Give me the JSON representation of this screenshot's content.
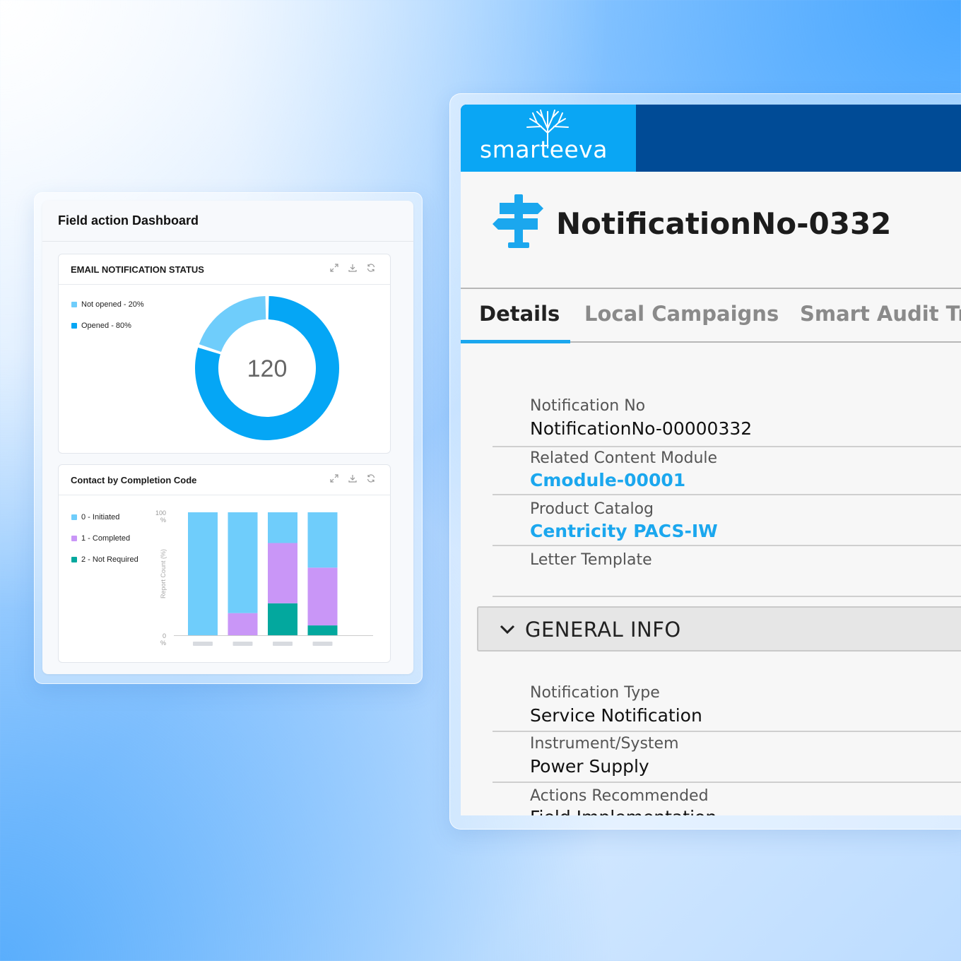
{
  "dashboard": {
    "title": "Field action Dashboard",
    "email_widget": {
      "title": "EMAIL NOTIFICATION STATUS",
      "center_value": "120",
      "legend": [
        {
          "label": "Not opened - 20%",
          "color": "#6fcdfb"
        },
        {
          "label": "Opened - 80%",
          "color": "#05a6f5"
        }
      ]
    },
    "contact_widget": {
      "title": "Contact by Completion Code",
      "legend": [
        {
          "label": "0 - Initiated",
          "color": "#6fcdfb"
        },
        {
          "label": "1 - Completed",
          "color": "#c996f7"
        },
        {
          "label": "2 - Not Required",
          "color": "#03a89e"
        }
      ]
    }
  },
  "chart_data": [
    {
      "type": "pie",
      "title": "EMAIL NOTIFICATION STATUS",
      "labels": [
        "Not opened",
        "Opened"
      ],
      "values": [
        20,
        80
      ],
      "center_label": "120",
      "colors": [
        "#6fcdfb",
        "#05a6f5"
      ]
    },
    {
      "type": "bar",
      "stacked": true,
      "title": "Contact by Completion Code",
      "ylabel": "Report Count (%)",
      "yticks": [
        "100\n%",
        "0\n%"
      ],
      "ylim": [
        0,
        100
      ],
      "categories": [
        "",
        "",
        "",
        ""
      ],
      "series": [
        {
          "name": "2 - Not Required",
          "values": [
            0,
            0,
            26,
            8
          ],
          "color": "#03a89e"
        },
        {
          "name": "1 - Completed",
          "values": [
            0,
            18,
            49,
            47
          ],
          "color": "#c996f7"
        },
        {
          "name": "0 - Initiated",
          "values": [
            100,
            82,
            25,
            45
          ],
          "color": "#6fcdfb"
        }
      ]
    }
  ],
  "notification": {
    "brand": "smarteeva",
    "title": "NotificationNo-0332",
    "tabs": [
      "Details",
      "Local Campaigns",
      "Smart Audit Tra"
    ],
    "fields": [
      {
        "label": "Notification No",
        "value": "NotificationNo-00000332",
        "link": false
      },
      {
        "label": "Related Content Module",
        "value": "Cmodule-00001",
        "link": true
      },
      {
        "label": "Product Catalog",
        "value": "Centricity PACS-IW",
        "link": true
      },
      {
        "label": "Letter Template",
        "value": "",
        "link": false
      }
    ],
    "section": "GENERAL INFO",
    "general_fields": [
      {
        "label": "Notification Type",
        "value": "Service Notification"
      },
      {
        "label": "Instrument/System",
        "value": "Power Supply"
      },
      {
        "label": "Actions Recommended",
        "value": "Field Implementation"
      }
    ]
  }
}
